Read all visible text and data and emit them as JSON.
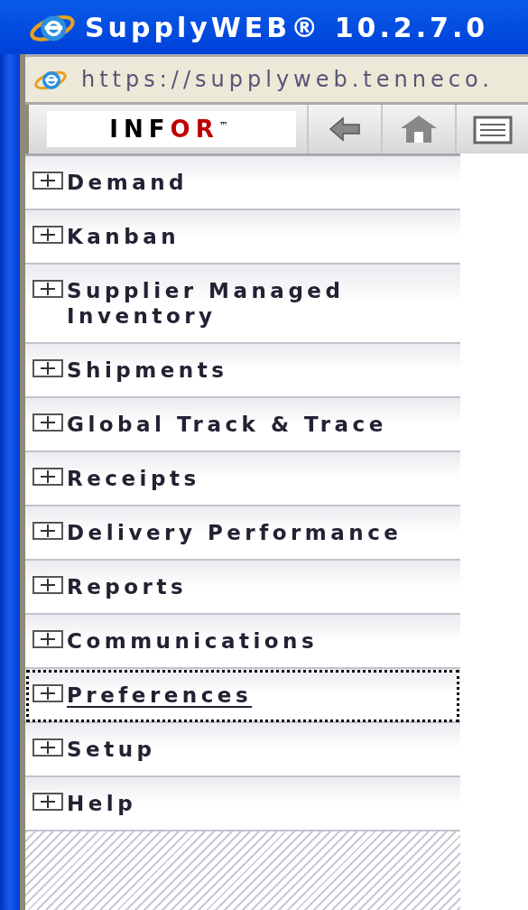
{
  "window": {
    "title": "SupplyWEB® 10.2.7.0"
  },
  "address_bar": {
    "url": "https://supplyweb.tenneco."
  },
  "toolbar": {
    "logo": {
      "main": "INF",
      "accent": "OR",
      "mark": "™"
    }
  },
  "menu": {
    "items": [
      {
        "label": "Demand",
        "expanded": false,
        "focused": false
      },
      {
        "label": "Kanban",
        "expanded": false,
        "focused": false
      },
      {
        "label": "Supplier Managed Inventory",
        "expanded": false,
        "focused": false
      },
      {
        "label": "Shipments",
        "expanded": false,
        "focused": false
      },
      {
        "label": "Global Track & Trace",
        "expanded": false,
        "focused": false
      },
      {
        "label": "Receipts",
        "expanded": false,
        "focused": false
      },
      {
        "label": "Delivery Performance",
        "expanded": false,
        "focused": false
      },
      {
        "label": "Reports",
        "expanded": false,
        "focused": false
      },
      {
        "label": "Communications",
        "expanded": false,
        "focused": false
      },
      {
        "label": "Preferences",
        "expanded": false,
        "focused": true
      },
      {
        "label": "Setup",
        "expanded": false,
        "focused": false
      },
      {
        "label": "Help",
        "expanded": false,
        "focused": false
      }
    ]
  }
}
